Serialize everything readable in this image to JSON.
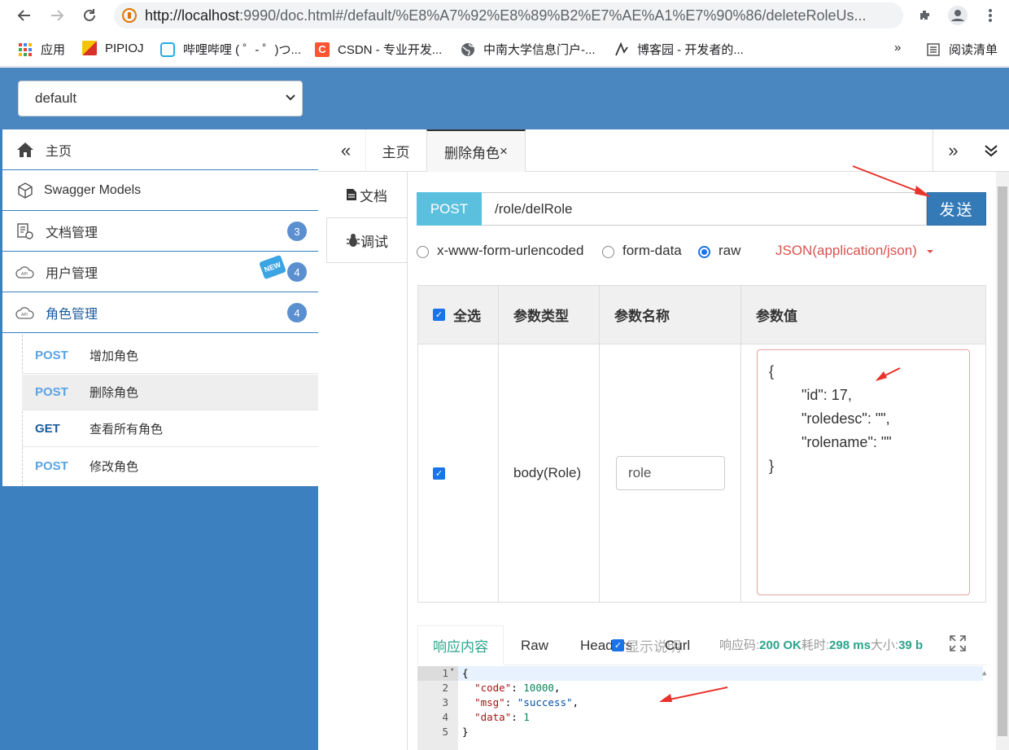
{
  "browser": {
    "url_host": "http://localhost",
    "url_rest": ":9990/doc.html#/default/%E8%A7%92%E8%89%B2%E7%AE%A1%E7%90%86/deleteRoleUs...",
    "bookmarks": [
      "应用",
      "PIPIOJ",
      "哔哩哔哩 ( ゜- ゜)つ...",
      "CSDN - 专业开发...",
      "中南大学信息门户-...",
      "博客园 - 开发者的..."
    ],
    "more_label": "»",
    "reading_list": "阅读清单"
  },
  "header": {
    "group_select": "default"
  },
  "sidebar": {
    "items": [
      {
        "label": "主页"
      },
      {
        "label": "Swagger Models"
      },
      {
        "label": "文档管理",
        "count": "3"
      },
      {
        "label": "用户管理",
        "count": "4",
        "tag": "NEW"
      },
      {
        "label": "角色管理",
        "count": "4"
      }
    ],
    "sub_items": [
      {
        "method": "POST",
        "name": "增加角色"
      },
      {
        "method": "POST",
        "name": "删除角色"
      },
      {
        "method": "GET",
        "name": "查看所有角色"
      },
      {
        "method": "POST",
        "name": "修改角色"
      }
    ]
  },
  "tabs": {
    "home": "主页",
    "active": "删除角色",
    "close": "×",
    "prev": "«",
    "next": "»"
  },
  "side_tabs": {
    "doc": "文档",
    "debug": "调试"
  },
  "request": {
    "method": "POST",
    "path": "/role/delRole",
    "send": "发送",
    "body_types": [
      "x-www-form-urlencoded",
      "form-data",
      "raw"
    ],
    "selected_body_type": "raw",
    "content_type": "JSON(application/json)"
  },
  "params": {
    "headers": [
      "全选",
      "参数类型",
      "参数名称",
      "参数值"
    ],
    "row": {
      "type": "body(Role)",
      "name": "role"
    },
    "value_lines": [
      "{",
      "        \"id\": 17,",
      "        \"roledesc\": \"\",",
      "        \"rolename\": \"\"",
      "}"
    ]
  },
  "response": {
    "tabs": [
      "响应内容",
      "Raw",
      "Headers",
      "Curl"
    ],
    "show_desc": "显示说明",
    "code_label": "响应码:",
    "code_value": "200 OK",
    "time_label": "耗时:",
    "time_value": "298 ms",
    "size_label": "大小:",
    "size_value": "39 b",
    "lines": [
      "1",
      "2",
      "3",
      "4",
      "5"
    ]
  },
  "colors": {
    "header": "#4a87c1",
    "send": "#337ab7",
    "post_badge": "#5bc0de",
    "accent_green": "#2aa58c"
  }
}
